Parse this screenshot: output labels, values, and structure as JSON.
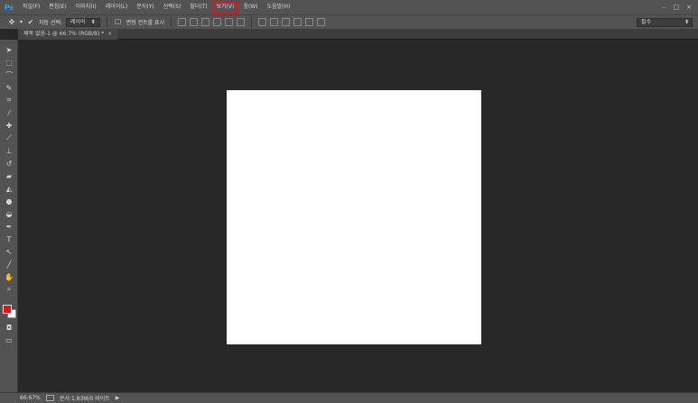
{
  "app": {
    "logo": "Ps"
  },
  "menu": [
    {
      "label": "파일(F)"
    },
    {
      "label": "편집(E)"
    },
    {
      "label": "이미지(I)"
    },
    {
      "label": "레이어(L)"
    },
    {
      "label": "문자(Y)"
    },
    {
      "label": "선택(S)"
    },
    {
      "label": "필터(T)"
    },
    {
      "label": "보기(V)",
      "highlighted": true
    },
    {
      "label": "창(W)"
    },
    {
      "label": "도움말(H)"
    }
  ],
  "window_controls": {
    "minimize": "–",
    "maximize": "□",
    "close": "×"
  },
  "options": {
    "tool_icon": "move-tool-icon",
    "auto_select_label": "자동 선택:",
    "auto_select_value": "레이어",
    "show_transform_label": "변형 컨트롤 표시",
    "workspace": "필수"
  },
  "document_tab": {
    "title": "제목 없음-1 @ 66.7% (RGB/8) *",
    "close": "×"
  },
  "toolbar_tools": [
    "move-tool-icon",
    "marquee-tool-icon",
    "lasso-tool-icon",
    "quick-select-tool-icon",
    "crop-tool-icon",
    "eyedropper-tool-icon",
    "healing-brush-tool-icon",
    "brush-tool-icon",
    "clone-stamp-tool-icon",
    "history-brush-tool-icon",
    "eraser-tool-icon",
    "gradient-tool-icon",
    "blur-tool-icon",
    "dodge-tool-icon",
    "pen-tool-icon",
    "type-tool-icon",
    "path-select-tool-icon",
    "line-tool-icon",
    "hand-tool-icon",
    "zoom-tool-icon"
  ],
  "colors": {
    "foreground": "#e0141b",
    "background": "#ffffff",
    "highlight": "#e0141b"
  },
  "status": {
    "zoom": "66.67%",
    "doc_info": "문서:1.83M/0 바이트"
  }
}
